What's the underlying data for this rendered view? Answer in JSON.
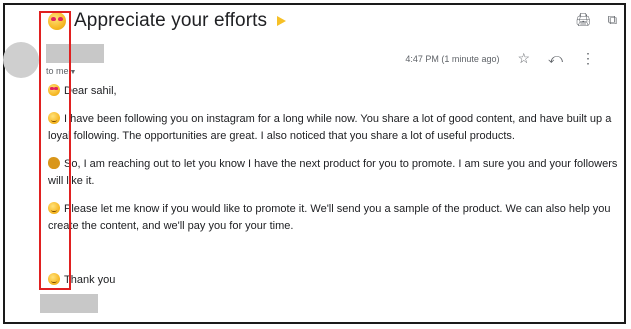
{
  "email": {
    "subject": "Appreciate your efforts",
    "recipient_label": "to me",
    "timestamp": "4:47 PM (1 minute ago)",
    "icons": {
      "subject_emoji": "heart-eyes-emoji",
      "label": "important-marker-icon",
      "print": "print-icon",
      "open_new_window": "open-in-new-window-icon",
      "star": "star-icon",
      "reply": "reply-icon",
      "more": "more-vertical-icon"
    },
    "greeting": "Dear sahil,",
    "paragraphs": [
      "I have been following you on instagram for a long while now. You share a lot of good content, and have built up a loyal following. The opportunities are great. I also noticed that you share a lot of useful products.",
      "So, I am reaching out to let you know I have the next product for you to promote. I am sure you and your followers will like it.",
      "Please let me know if you would like to promote it. We'll send you a sample of the product. We can also help you create the content, and we'll pay you for your time."
    ],
    "closing": "Thank you"
  },
  "colors": {
    "highlight": "#e02020",
    "label_marker": "#f6c026",
    "redaction": "#c8c8c8"
  }
}
